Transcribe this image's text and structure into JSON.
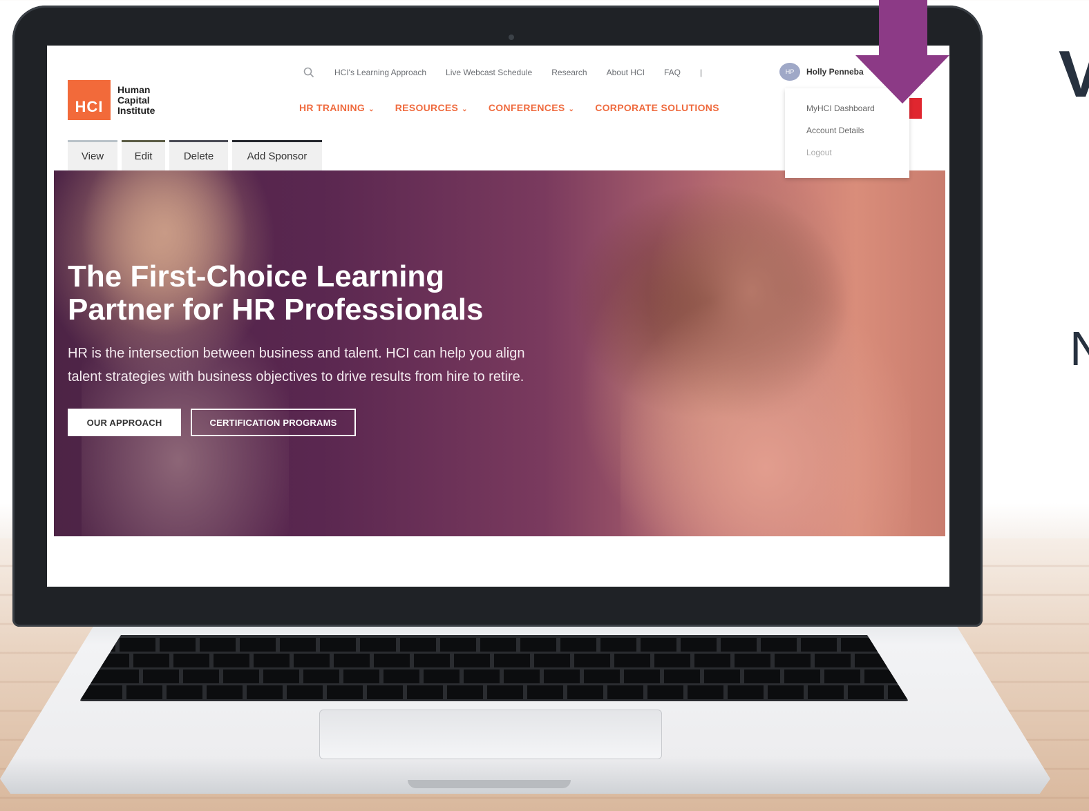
{
  "background": {
    "deco_big": "V",
    "deco_small": "N"
  },
  "site": {
    "logo": {
      "mark": "HCI",
      "line1": "Human",
      "line2": "Capital",
      "line3": "Institute",
      "color": "#f26a3a"
    },
    "utility_nav": {
      "links": [
        "HCI's Learning Approach",
        "Live Webcast Schedule",
        "Research",
        "About HCI",
        "FAQ"
      ],
      "separator": "|"
    },
    "user": {
      "avatar_initials": "HP",
      "name": "Holly Penneba"
    },
    "main_nav": {
      "items": [
        {
          "label": "HR TRAINING",
          "has_menu": true
        },
        {
          "label": "RESOURCES",
          "has_menu": true
        },
        {
          "label": "CONFERENCES",
          "has_menu": true
        },
        {
          "label": "CORPORATE SOLUTIONS",
          "has_menu": false
        }
      ],
      "color": "#ef6b3f"
    },
    "user_menu": {
      "items": [
        "MyHCI Dashboard",
        "Account Details",
        "Logout"
      ]
    },
    "admin_tabs": [
      "View",
      "Edit",
      "Delete",
      "Add Sponsor"
    ],
    "hero": {
      "title_line1": "The First-Choice Learning",
      "title_line2": "Partner for HR Professionals",
      "text_line1": "HR is the intersection between business and talent. HCI can help you align",
      "text_line2": "talent strategies with business objectives to drive results from hire to retire.",
      "buttons": [
        "OUR APPROACH",
        "CERTIFICATION PROGRAMS"
      ]
    }
  },
  "annotation": {
    "arrow_color": "#8c3a86"
  }
}
